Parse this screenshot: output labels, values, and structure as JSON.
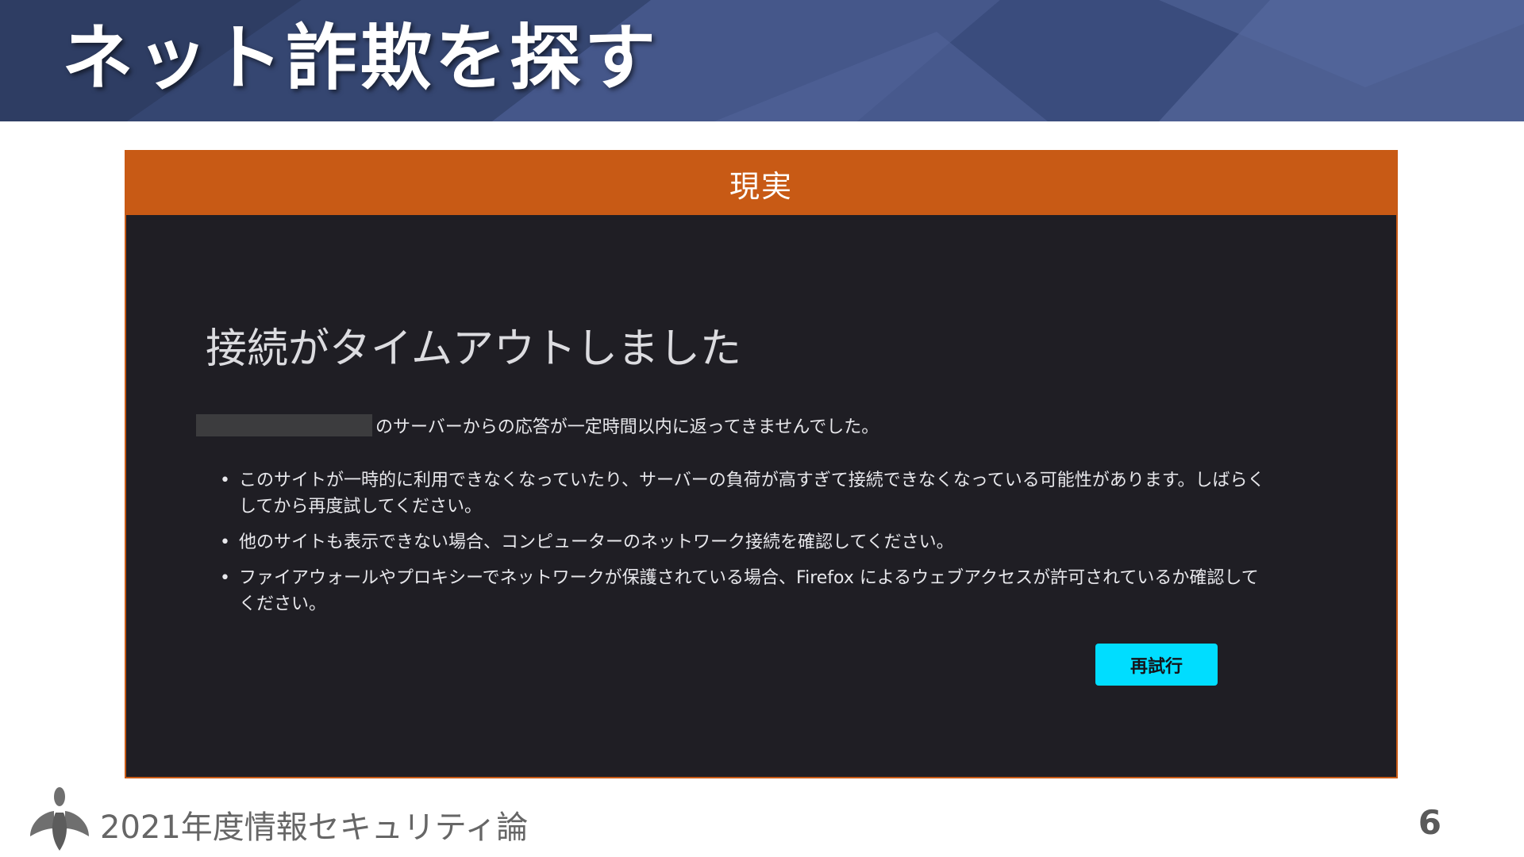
{
  "slide": {
    "title": "ネット詐欺を探す",
    "footer": "2021年度情報セキュリティ論",
    "page_number": "6"
  },
  "panel": {
    "header": "現実"
  },
  "error_page": {
    "title": "接続がタイムアウトしました",
    "description": "のサーバーからの応答が一定時間以内に返ってきませんでした。",
    "bullets": [
      "このサイトが一時的に利用できなくなっていたり、サーバーの負荷が高すぎて接続できなくなっている可能性があります。しばらくしてから再度試してください。",
      "他のサイトも表示できない場合、コンピューターのネットワーク接続を確認してください。",
      "ファイアウォールやプロキシーでネットワークが保護されている場合、Firefox によるウェブアクセスが許可されているか確認してください。"
    ],
    "retry_label": "再試行"
  },
  "icons": {
    "logo": "leaf-logo-icon",
    "bullet": "bullet-dot-icon"
  },
  "colors": {
    "header_bg": "#3d4f7c",
    "panel_accent": "#c85a15",
    "error_bg": "#1f1e24",
    "retry_button": "#00ddff"
  }
}
